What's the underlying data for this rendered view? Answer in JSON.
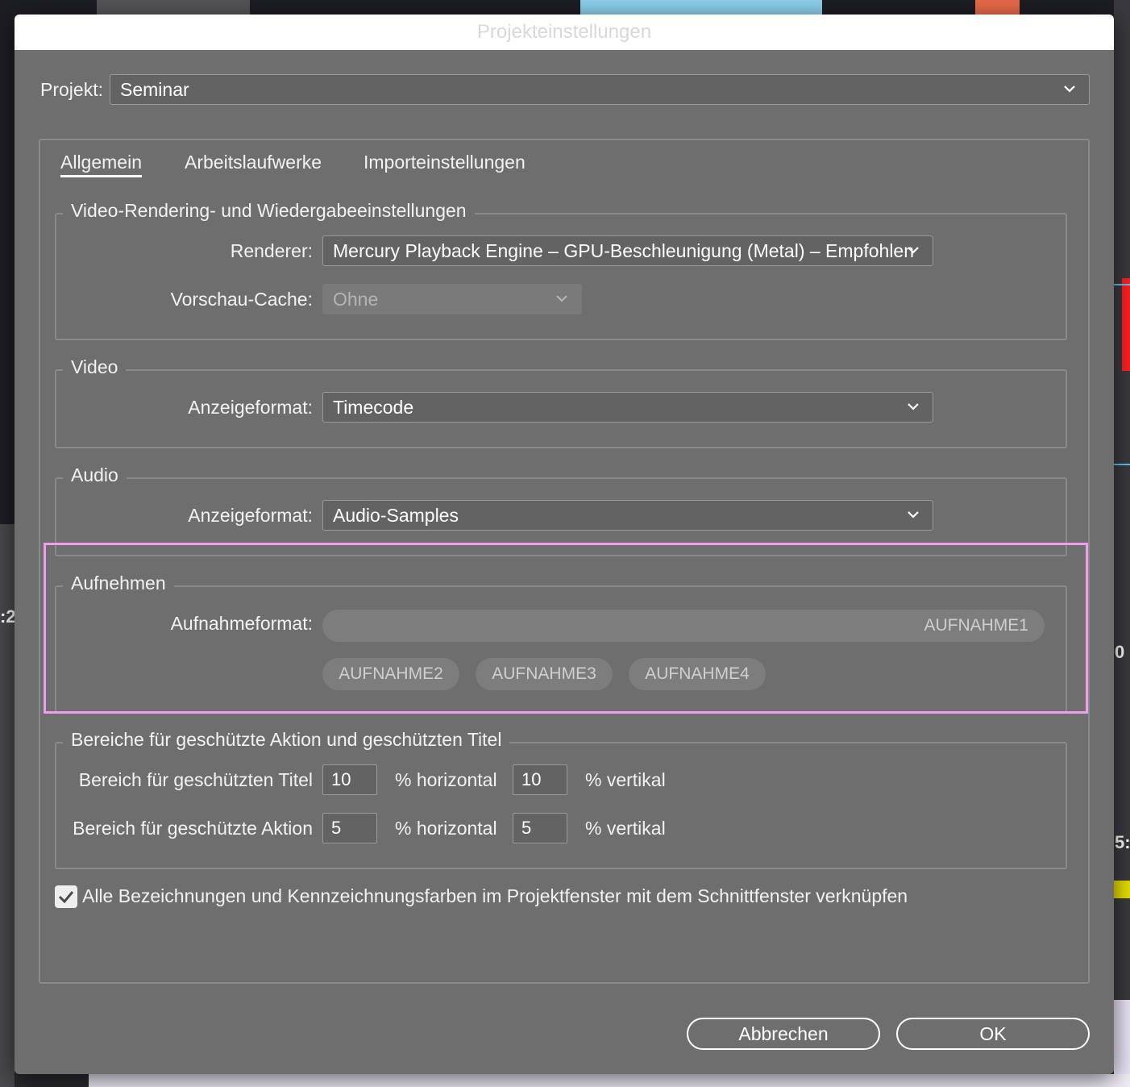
{
  "window": {
    "title": "Projekteinstellungen"
  },
  "project": {
    "label": "Projekt:",
    "value": "Seminar"
  },
  "tabs": [
    {
      "label": "Allgemein",
      "active": true
    },
    {
      "label": "Arbeitslaufwerke",
      "active": false
    },
    {
      "label": "Importeinstellungen",
      "active": false
    }
  ],
  "video_rendering": {
    "title": "Video-Rendering- und Wiedergabeeinstellungen",
    "renderer_label": "Renderer:",
    "renderer_value": "Mercury Playback Engine – GPU-Beschleunigung (Metal) – Empfohlen",
    "cache_label": "Vorschau-Cache:",
    "cache_value": "Ohne"
  },
  "video": {
    "title": "Video",
    "format_label": "Anzeigeformat:",
    "format_value": "Timecode"
  },
  "audio": {
    "title": "Audio",
    "format_label": "Anzeigeformat:",
    "format_value": "Audio-Samples"
  },
  "capture": {
    "title": "Aufnehmen",
    "format_label": "Aufnahmeformat:",
    "selected": "AUFNAHME1",
    "options": [
      "AUFNAHME2",
      "AUFNAHME3",
      "AUFNAHME4"
    ]
  },
  "safe_margins": {
    "title": "Bereiche für geschützte Aktion und geschützten Titel",
    "title_safe_label": "Bereich für geschützten Titel",
    "title_safe_h": "10",
    "title_safe_v": "10",
    "action_safe_label": "Bereich für geschützte Aktion",
    "action_safe_h": "5",
    "action_safe_v": "5",
    "horizontal_label": "% horizontal",
    "vertical_label": "% vertikal"
  },
  "link_option": {
    "checked": true,
    "label": "Alle Bezeichnungen und Kennzeichnungsfarben im Projektfenster mit dem Schnittfenster verknüpfen"
  },
  "buttons": {
    "cancel": "Abbrechen",
    "ok": "OK"
  },
  "background": {
    "left_fragment": ":2",
    "right_fragment_1": "0",
    "right_fragment_2": "5:"
  },
  "colors": {
    "highlight": "#f29cf0",
    "dialog_bg": "#6e6e6e"
  }
}
